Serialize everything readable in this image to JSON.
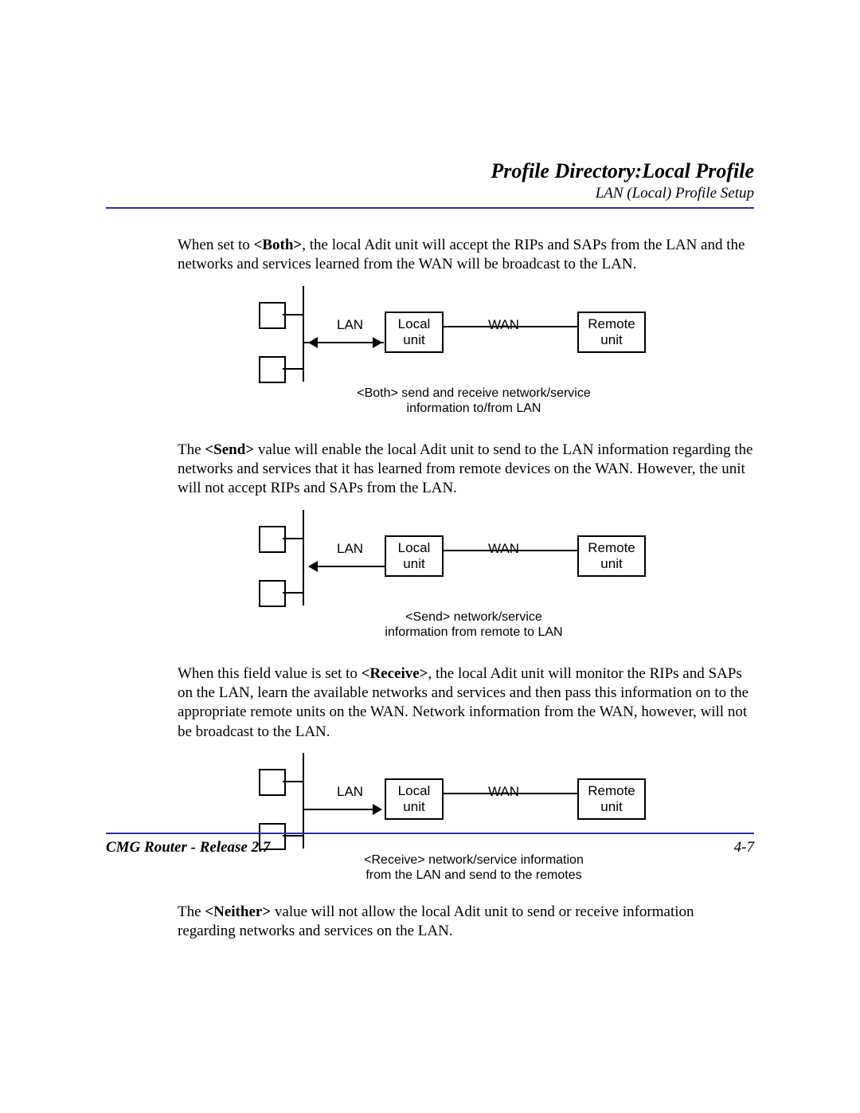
{
  "header": {
    "title": "Profile Directory:Local Profile",
    "subtitle": "LAN (Local) Profile Setup"
  },
  "paragraphs": {
    "p1a": "When set to ",
    "p1b": "<Both>",
    "p1c": ", the local Adit unit will accept the RIPs and SAPs from the LAN and the networks and services learned from the WAN will be broadcast to the LAN.",
    "p2a": "The ",
    "p2b": "<Send>",
    "p2c": " value will enable the local Adit unit to send to the LAN information regarding the networks and services that it has learned from remote devices on the WAN. However, the unit will not accept RIPs and SAPs from the LAN.",
    "p3a": "When this field value is set to ",
    "p3b": "<Receive>",
    "p3c": ", the local Adit unit will monitor the RIPs and SAPs on the LAN, learn the available networks and services and then pass this information on to the appropriate remote units on the WAN. Network information from the WAN, however, will not be broadcast to the LAN.",
    "p4a": "The ",
    "p4b": "<Neither>",
    "p4c": " value will not allow the local Adit unit to send or receive information regarding networks and services on the LAN."
  },
  "diagram_labels": {
    "lan": "LAN",
    "wan": "WAN",
    "local_unit_l1": "Local",
    "local_unit_l2": "unit",
    "remote_unit_l1": "Remote",
    "remote_unit_l2": "unit"
  },
  "captions": {
    "both_l1": "<Both> send and receive network/service",
    "both_l2": "information to/from LAN",
    "send_l1": "<Send> network/service",
    "send_l2": "information from remote to LAN",
    "receive_l1": "<Receive> network/service information",
    "receive_l2": "from the LAN and send to the remotes"
  },
  "footer": {
    "left": "CMG Router - Release 2.7",
    "right": "4-7"
  }
}
